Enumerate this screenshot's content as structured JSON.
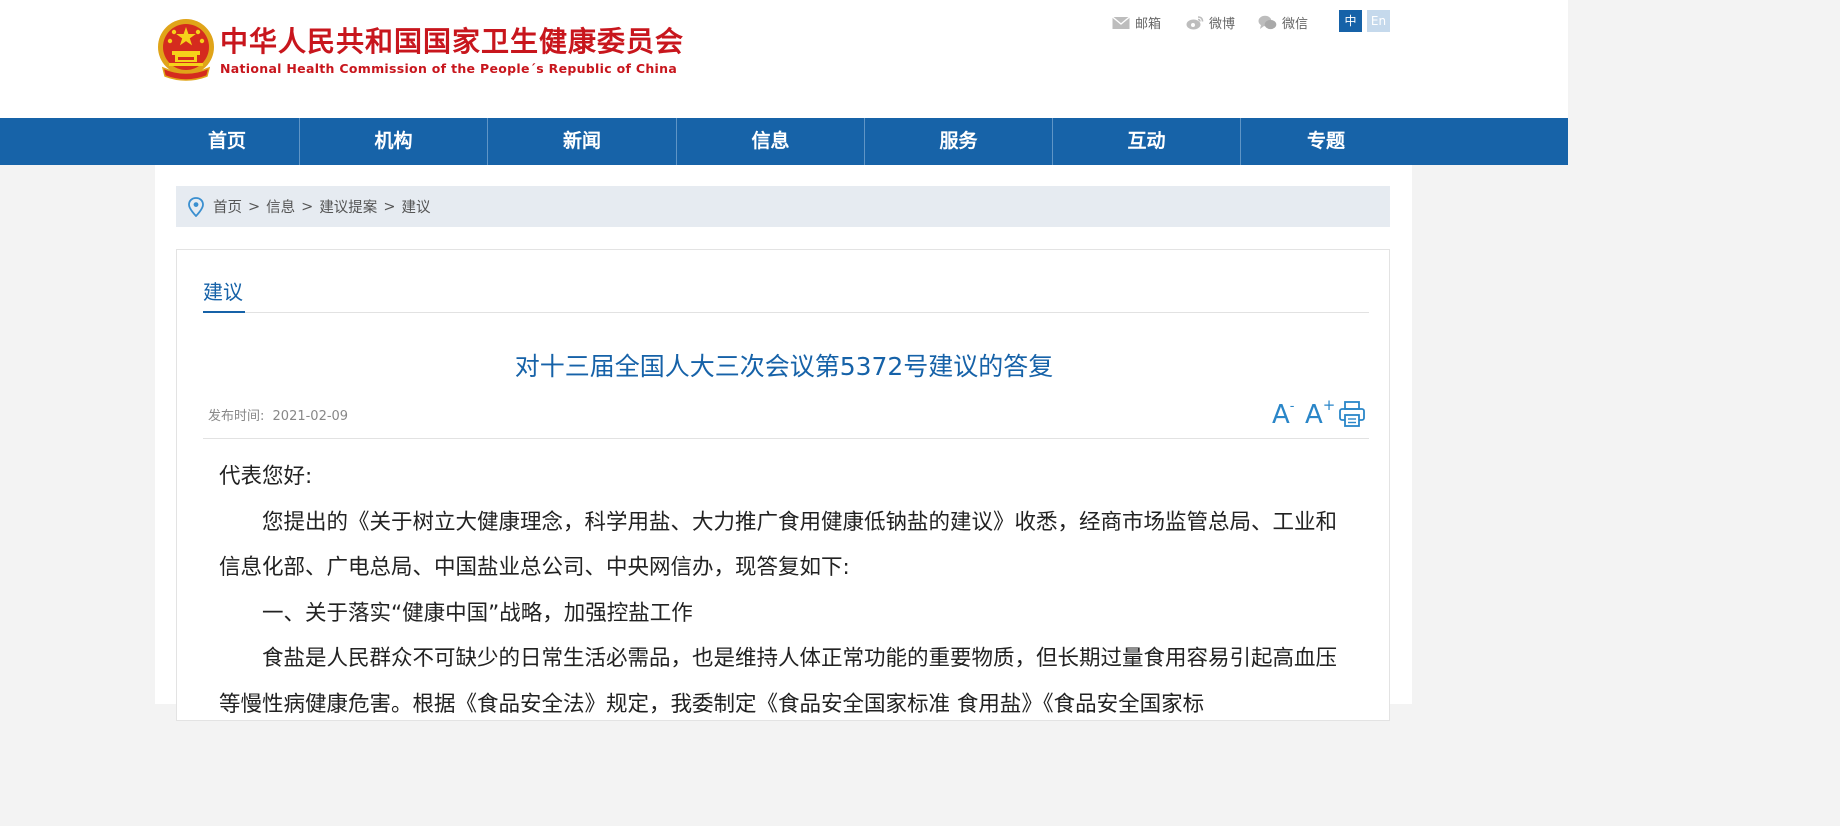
{
  "header": {
    "title_cn": "中华人民共和国国家卫生健康委员会",
    "title_en": "National Health Commission of the People´s Republic of China",
    "links": [
      {
        "label": "邮箱",
        "icon": "mail-icon"
      },
      {
        "label": "微博",
        "icon": "weibo-icon"
      },
      {
        "label": "微信",
        "icon": "wechat-icon"
      }
    ],
    "lang_cn": "中",
    "lang_en": "En"
  },
  "nav": {
    "items": [
      {
        "label": "首页"
      },
      {
        "label": "机构"
      },
      {
        "label": "新闻"
      },
      {
        "label": "信息"
      },
      {
        "label": "服务"
      },
      {
        "label": "互动"
      },
      {
        "label": "专题"
      }
    ]
  },
  "breadcrumb": {
    "items": [
      "首页",
      "信息",
      "建议提案",
      "建议"
    ],
    "separator": ">"
  },
  "section": {
    "title": "建议"
  },
  "article": {
    "title": "对十三届全国人大三次会议第5372号建议的答复",
    "date_label": "发布时间:",
    "date": "2021-02-09",
    "paragraphs": [
      "代表您好:",
      "您提出的《关于树立大健康理念，科学用盐、大力推广食用健康低钠盐的建议》收悉，经商市场监管总局、工业和信息化部、广电总局、中国盐业总公司、中央网信办，现答复如下:",
      "一、关于落实“健康中国”战略，加强控盐工作",
      "食盐是人民群众不可缺少的日常生活必需品，也是维持人体正常功能的重要物质，但长期过量食用容易引起高血压等慢性病健康危害。根据《食品安全法》规定，我委制定《食品安全国家标准 食用盐》《食品安全国家标"
    ]
  },
  "tools": {
    "font_small": "A",
    "font_small_sup": "-",
    "font_large": "A",
    "font_large_sup": "+"
  },
  "colors": {
    "brand_red": "#c8161d",
    "nav_blue": "#1763a8",
    "link_blue": "#1662a8"
  }
}
